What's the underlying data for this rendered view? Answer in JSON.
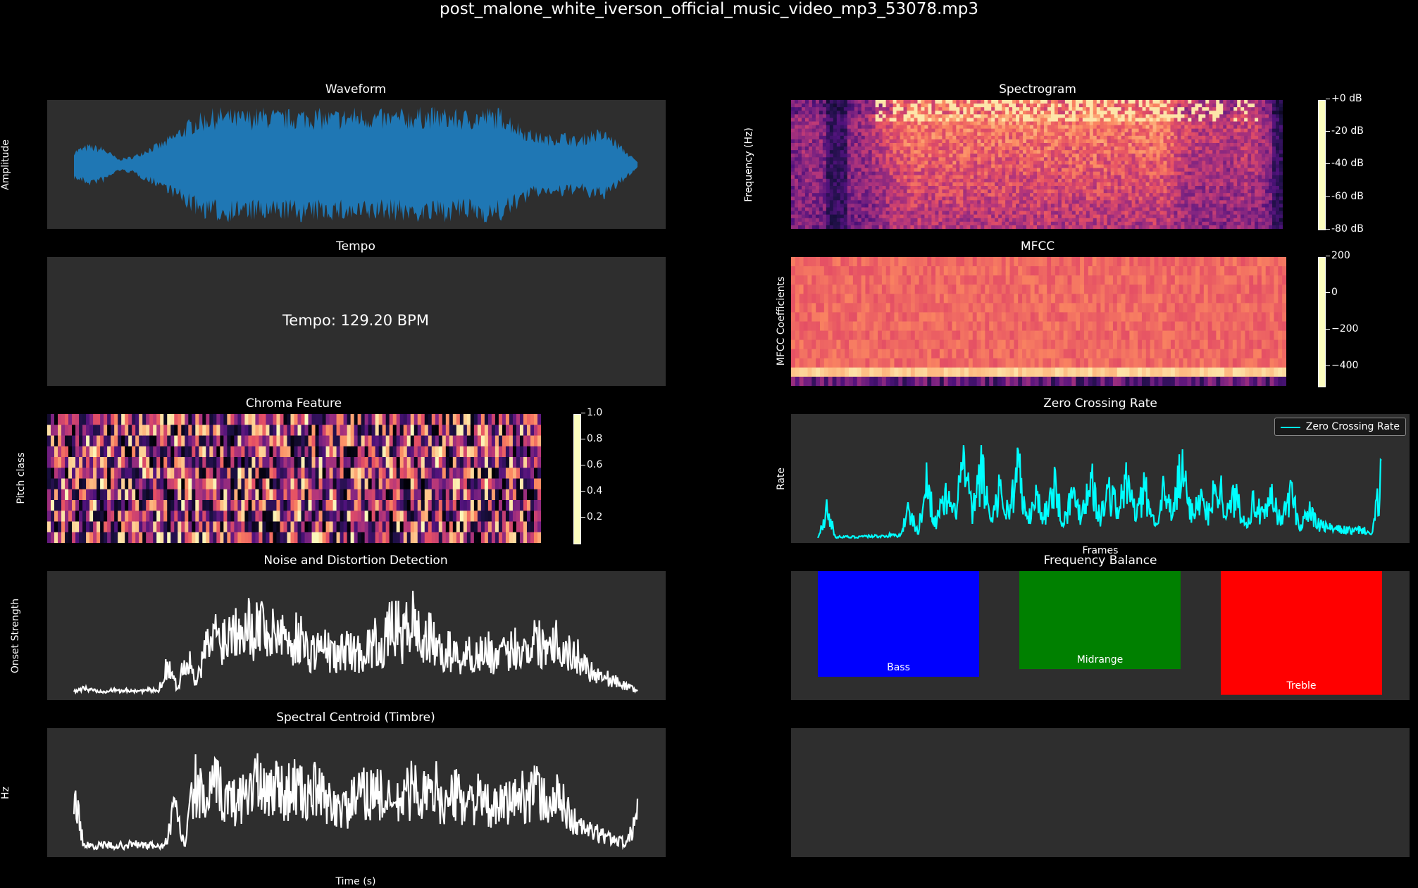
{
  "suptitle": "post_malone_white_iverson_official_music_video_mp3_53078.mp3",
  "waveform": {
    "title": "Waveform",
    "ylabel": "Amplitude",
    "color": "#1f77b4"
  },
  "spectrogram": {
    "title": "Spectrogram",
    "ylabel": "Frequency (Hz)",
    "colorbar_ticks": [
      "+0 dB",
      "-20 dB",
      "-40 dB",
      "-60 dB",
      "-80 dB"
    ]
  },
  "tempo": {
    "title": "Tempo",
    "text": "Tempo: 129.20 BPM"
  },
  "mfcc": {
    "title": "MFCC",
    "ylabel": "MFCC Coefficients",
    "colorbar_ticks": [
      "200",
      "0",
      "−200",
      "−400"
    ]
  },
  "chroma": {
    "title": "Chroma Feature",
    "ylabel": "Pitch class",
    "colorbar_ticks": [
      "1.0",
      "0.8",
      "0.6",
      "0.4",
      "0.2"
    ]
  },
  "zcr": {
    "title": "Zero Crossing Rate",
    "ylabel": "Rate",
    "xlabel": "Frames",
    "legend": "Zero Crossing Rate",
    "color": "#00ffff"
  },
  "noise": {
    "title": "Noise and Distortion Detection",
    "ylabel": "Onset Strength"
  },
  "balance": {
    "title": "Frequency Balance"
  },
  "centroid": {
    "title": "Spectral Centroid (Timbre)",
    "ylabel": "Hz",
    "xlabel": "Time (s)"
  },
  "chart_data": [
    {
      "type": "area",
      "title": "Waveform",
      "ylabel": "Amplitude",
      "envelope": [
        0.25,
        0.35,
        0.3,
        0.1,
        0.15,
        0.3,
        0.4,
        0.6,
        0.8,
        0.9,
        0.95,
        0.9,
        0.92,
        0.95,
        0.9,
        0.93,
        0.95,
        0.9,
        0.92,
        0.95,
        0.93,
        0.9,
        0.92,
        0.94,
        0.95,
        0.93,
        0.9,
        0.92,
        0.95,
        0.93,
        0.7,
        0.55,
        0.5,
        0.55,
        0.45,
        0.6,
        0.55,
        0.3,
        0.05
      ]
    },
    {
      "type": "heatmap",
      "title": "Spectrogram",
      "ylabel": "Frequency (Hz)",
      "colorbar_range_db": [
        -80,
        0
      ]
    },
    {
      "type": "table",
      "title": "Tempo",
      "bpm": 129.2
    },
    {
      "type": "heatmap",
      "title": "MFCC",
      "ylabel": "MFCC Coefficients",
      "colorbar_range": [
        -500,
        200
      ]
    },
    {
      "type": "heatmap",
      "title": "Chroma Feature",
      "ylabel": "Pitch class",
      "rows": 12,
      "colorbar_range": [
        0,
        1
      ]
    },
    {
      "type": "line",
      "title": "Zero Crossing Rate",
      "ylabel": "Rate",
      "xlabel": "Frames",
      "series": [
        {
          "name": "Zero Crossing Rate",
          "values": [
            0.02,
            0.35,
            0.03,
            0.03,
            0.03,
            0.04,
            0.04,
            0.04,
            0.05,
            0.05,
            0.35,
            0.08,
            0.7,
            0.2,
            0.5,
            0.3,
            0.95,
            0.3,
            0.85,
            0.25,
            0.6,
            0.3,
            0.9,
            0.2,
            0.5,
            0.3,
            0.7,
            0.2,
            0.55,
            0.3,
            0.8,
            0.25,
            0.6,
            0.35,
            0.7,
            0.3,
            0.6,
            0.2,
            0.55,
            0.3,
            0.85,
            0.35,
            0.5,
            0.3,
            0.75,
            0.3,
            0.55,
            0.2,
            0.45,
            0.25,
            0.5,
            0.2,
            0.6,
            0.15,
            0.35,
            0.18,
            0.15,
            0.12,
            0.12,
            0.1,
            0.12,
            0.06,
            0.75
          ]
        }
      ]
    },
    {
      "type": "line",
      "title": "Noise and Distortion Detection",
      "ylabel": "Onset Strength",
      "series": [
        {
          "name": "",
          "values": [
            0.05,
            0.08,
            0.06,
            0.05,
            0.06,
            0.05,
            0.06,
            0.05,
            0.06,
            0.05,
            0.4,
            0.08,
            0.5,
            0.12,
            0.55,
            0.75,
            0.7,
            0.85,
            0.95,
            0.8,
            0.9,
            0.7,
            0.85,
            0.6,
            0.75,
            0.5,
            0.6,
            0.55,
            0.45,
            0.6,
            0.5,
            0.55,
            0.65,
            0.6,
            0.9,
            0.7,
            0.95,
            0.65,
            0.7,
            0.5,
            0.55,
            0.45,
            0.5,
            0.5,
            0.55,
            0.45,
            0.5,
            0.6,
            0.55,
            0.7,
            0.6,
            0.75,
            0.55,
            0.5,
            0.45,
            0.3,
            0.25,
            0.2,
            0.15,
            0.1,
            0.05
          ]
        }
      ]
    },
    {
      "type": "bar",
      "title": "Frequency Balance",
      "categories": [
        "Bass",
        "Midrange",
        "Treble"
      ],
      "values": [
        0.82,
        0.76,
        0.96
      ],
      "colors": [
        "#0000ff",
        "#008000",
        "#ff0000"
      ]
    },
    {
      "type": "line",
      "title": "Spectral Centroid (Timbre)",
      "ylabel": "Hz",
      "xlabel": "Time (s)",
      "series": [
        {
          "name": "",
          "values": [
            0.75,
            0.1,
            0.1,
            0.1,
            0.1,
            0.1,
            0.12,
            0.1,
            0.1,
            0.08,
            0.55,
            0.1,
            0.9,
            0.6,
            0.85,
            0.7,
            0.65,
            0.75,
            0.95,
            0.7,
            0.9,
            0.75,
            0.85,
            0.7,
            0.8,
            0.65,
            0.6,
            0.55,
            0.7,
            0.75,
            0.8,
            0.65,
            0.6,
            0.75,
            0.85,
            0.7,
            0.8,
            0.6,
            0.75,
            0.65,
            0.7,
            0.6,
            0.55,
            0.65,
            0.7,
            0.75,
            0.8,
            0.6,
            0.7,
            0.55,
            0.35,
            0.3,
            0.25,
            0.2,
            0.18,
            0.12,
            0.55
          ]
        }
      ]
    }
  ]
}
